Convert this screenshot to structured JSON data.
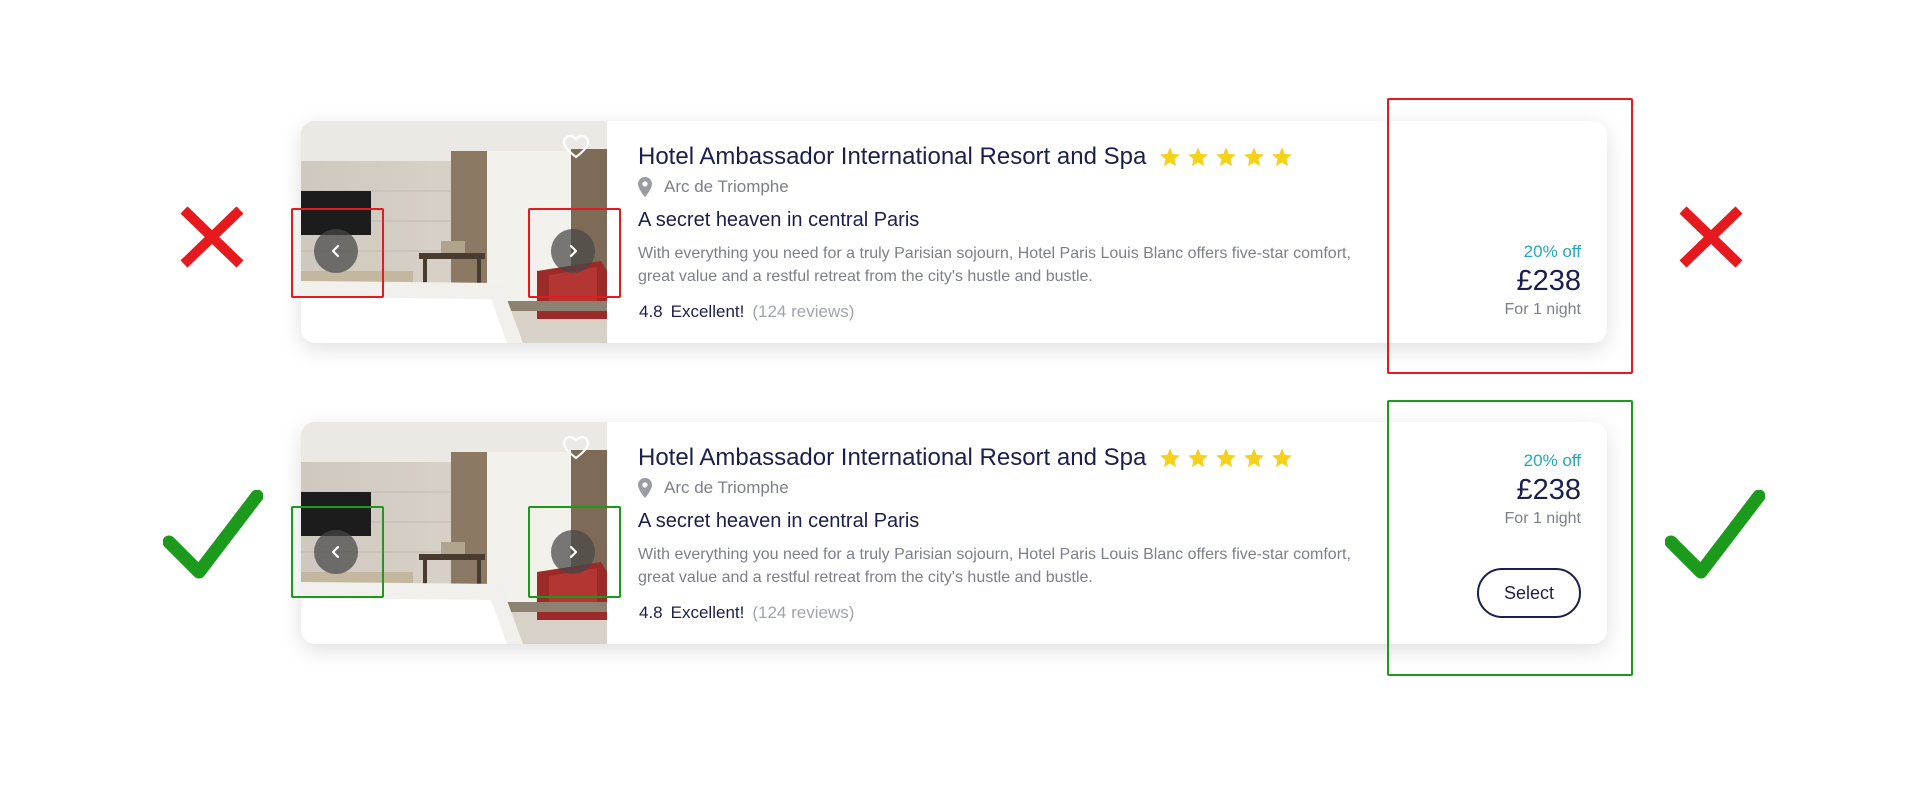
{
  "colors": {
    "navy": "#1b1f4b",
    "teal": "#26a6b8",
    "gray_text": "#7d7f89",
    "star": "#f4d21a",
    "wrong": "#e6191e",
    "right": "#1b9a1b"
  },
  "cards": [
    {
      "title": "Hotel Ambassador International Resort and Spa",
      "stars": 5,
      "location": "Arc de Triomphe",
      "tagline": "A secret heaven in central Paris",
      "description": "With everything you need for a truly Parisian sojourn, Hotel Paris Louis Blanc offers five-star comfort, great value and a restful retreat from the city's hustle and bustle.",
      "rating_score": "4.8",
      "rating_word": "Excellent!",
      "rating_count": "(124 reviews)",
      "discount": "20% off",
      "price": "£238",
      "per_night": "For 1 night",
      "verdict": "cross"
    },
    {
      "title": "Hotel Ambassador International Resort and Spa",
      "stars": 5,
      "location": "Arc de Triomphe",
      "tagline": "A secret heaven in central Paris",
      "description": "With everything you need for a truly Parisian sojourn, Hotel Paris Louis Blanc offers five-star comfort, great value and a restful retreat from the city's hustle and bustle.",
      "rating_score": "4.8",
      "rating_word": "Excellent!",
      "rating_count": "(124 reviews)",
      "discount": "20% off",
      "price": "£238",
      "per_night": "For 1 night",
      "select_label": "Select",
      "verdict": "check"
    }
  ],
  "icons": {
    "favorite": "heart-icon",
    "prev": "chevron-left-icon",
    "next": "chevron-right-icon",
    "location": "map-pin-icon",
    "star": "star-icon",
    "wrong": "cross-icon",
    "right": "checkmark-icon"
  }
}
